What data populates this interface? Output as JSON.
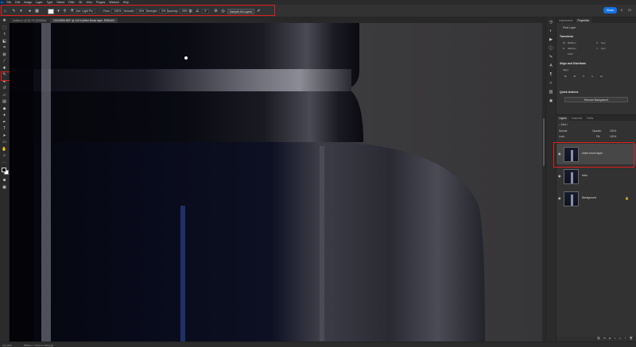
{
  "app": {
    "logo": "Ps"
  },
  "menu": [
    "File",
    "Edit",
    "Image",
    "Layer",
    "Type",
    "Select",
    "Filter",
    "3D",
    "View",
    "Plugins",
    "Window",
    "Help"
  ],
  "options": {
    "mode_label": "Mode: Lighten",
    "size_value": "Use: Light Pro",
    "flow_label": "Flow:",
    "flow_value": "100%",
    "smooth_label": "Smooth:",
    "smooth_value": "10%",
    "strength_label": "Strength:",
    "strength_value": "0%",
    "spacing_label": "Spacing:",
    "spacing_value": "25%",
    "angle_value": "0°",
    "sample_button": "Sample All Layers",
    "share_button": "Share"
  },
  "documents": [
    {
      "title": "Untitled-1 @ 66.7% (RGB/8#)",
      "active": false
    },
    {
      "title": "20XX0909.NEF @ 141% (Mixer Brush layer, RGB/16*)",
      "active": true
    }
  ],
  "status": {
    "zoom": "141.04%",
    "doc_size": "5568 px x 3712 px (300 ppi)"
  },
  "panels": {
    "tabs": [
      "Adjustments",
      "Properties"
    ],
    "active_tab": "Properties",
    "pixel_layer_label": "Pixel Layer",
    "transform_heading": "Transform",
    "w_label": "W",
    "w_value": "6048 px",
    "h_label": "H",
    "h_value": "4024 px",
    "x_label": "X",
    "x_value": "0 px",
    "y_label": "Y",
    "y_value": "0 px",
    "angle_value": "0.00°",
    "align_heading": "Align and Distribute",
    "align_label": "Align:",
    "quick_actions_heading": "Quick Actions",
    "remove_bg_button": "Remove Background"
  },
  "layers_panel": {
    "tabs": [
      "Layers",
      "Channels",
      "Paths"
    ],
    "kind_label": "Kind",
    "blend_mode": "Normal",
    "opacity_label": "Opacity:",
    "opacity_value": "100%",
    "lock_label": "Lock:",
    "fill_label": "Fill:",
    "fill_value": "100%",
    "layers": [
      {
        "name": "mixer brush layer",
        "selected": true
      },
      {
        "name": "retro",
        "selected": false
      },
      {
        "name": "Background",
        "selected": false,
        "locked": true
      }
    ]
  },
  "icons": {
    "home": "home-icon",
    "brush": "mixer-brush-icon",
    "search": "search-icon",
    "workspace": "workspace-icon",
    "layer_visible": "eye-icon",
    "lock": "lock-icon"
  }
}
